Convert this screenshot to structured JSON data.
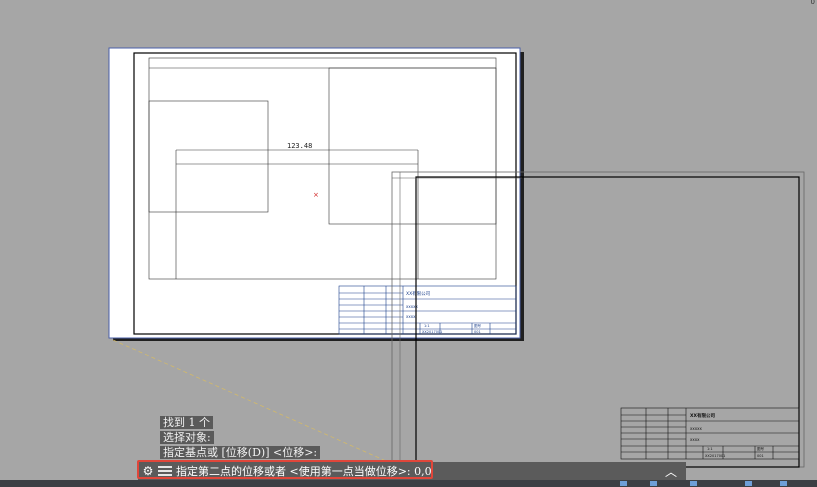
{
  "app": {
    "corner_mark": "0"
  },
  "command_history": [
    "找到 1 个",
    "选择对象:",
    "指定基点或 [位移(D)] <位移>:"
  ],
  "command_line": {
    "prompt": "指定第二点的位移或者 <使用第一点当做位移>: 0,0",
    "icons": [
      "gear-icon",
      "menu-icon",
      "chevron-up-icon"
    ]
  },
  "drawing": {
    "dimension_text": "123.48",
    "title_block": {
      "company": "XX有限公司",
      "line1": "xxxxx",
      "line2": "xxxx",
      "ratio": "1:1",
      "sheet": "1",
      "total": "1",
      "drawing_no": "XX2017001",
      "material": "图号",
      "code": "001"
    }
  },
  "colors": {
    "background": "#a6a6a6",
    "highlight": "#e0463a",
    "cmdbar": "#5b5b5b"
  }
}
